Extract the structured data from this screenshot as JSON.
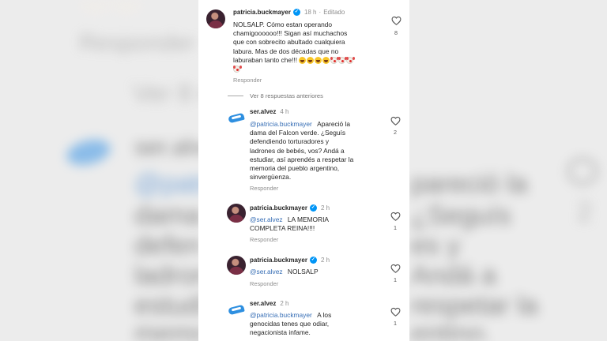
{
  "colors": {
    "verified": "#0095f6",
    "mention": "#376eb5",
    "meta": "#8e8e8e",
    "text": "#262626"
  },
  "background": {
    "reply_label": "Responder",
    "see_more": "Ver 8 r",
    "partial_user": "ser.alve",
    "partial_lines": [
      "@patri",
      "dama d",
      "defen",
      "ladron",
      "estudi",
      "memor"
    ],
    "right_lines": [
      "pareció la",
      "¿Seguís",
      "es y",
      "Andá a",
      "respetar la",
      "entino,"
    ],
    "like_count": "2"
  },
  "comments": [
    {
      "id": "c1",
      "avatar": "patricia-avatar",
      "username": "patricia.buckmayer",
      "verified": true,
      "time": "18 h",
      "edited": "Editado",
      "text_lines": [
        "NOLSALP. Cómo estan operando",
        "chamigoooooo!!! Sigan así muchachos",
        "que con sobrecito abultado cualquiera",
        "labura. Mas de dos décadas que no",
        "laburaban tanto che!!!"
      ],
      "emojis": [
        "face-with-tears-of-joy",
        "face-with-tears-of-joy",
        "face-with-tears-of-joy",
        "face-with-tears-of-joy",
        "clown-face",
        "clown-face",
        "clown-face",
        "clown-face"
      ],
      "reply_label": "Responder",
      "likes": "8"
    },
    {
      "id": "c2",
      "avatar": "ser-alvez-avatar",
      "username": "ser.alvez",
      "verified": false,
      "time": "4 h",
      "mention": "@patricia.buckmayer",
      "text_lines": [
        "Apareció la",
        "dama del Falcon verde. ¿Seguís",
        "defendiendo torturadores y",
        "ladrones de bebés, vos? Andá a",
        "estudiar, así aprendés a respetar la",
        "memoria del pueblo argentino,",
        "sinvergüenza."
      ],
      "reply_label": "Responder",
      "likes": "2"
    },
    {
      "id": "c3",
      "avatar": "patricia-avatar",
      "username": "patricia.buckmayer",
      "verified": true,
      "time": "2 h",
      "mention": "@ser.alvez",
      "text_lines": [
        "LA MEMORIA",
        "COMPLETA REINA!!!!"
      ],
      "reply_label": "Responder",
      "likes": "1"
    },
    {
      "id": "c4",
      "avatar": "patricia-avatar",
      "username": "patricia.buckmayer",
      "verified": true,
      "time": "2 h",
      "mention": "@ser.alvez",
      "text_lines": [
        "NOLSALP"
      ],
      "reply_label": "Responder",
      "likes": "1"
    },
    {
      "id": "c5",
      "avatar": "ser-alvez-avatar",
      "username": "ser.alvez",
      "verified": false,
      "time": "2 h",
      "mention": "@patricia.buckmayer",
      "text_lines": [
        "A los",
        "genocidas tenes que odiar,",
        "negacionista infame."
      ],
      "likes": "1"
    }
  ],
  "see_previous": "Ver 8 respuestas anteriores"
}
